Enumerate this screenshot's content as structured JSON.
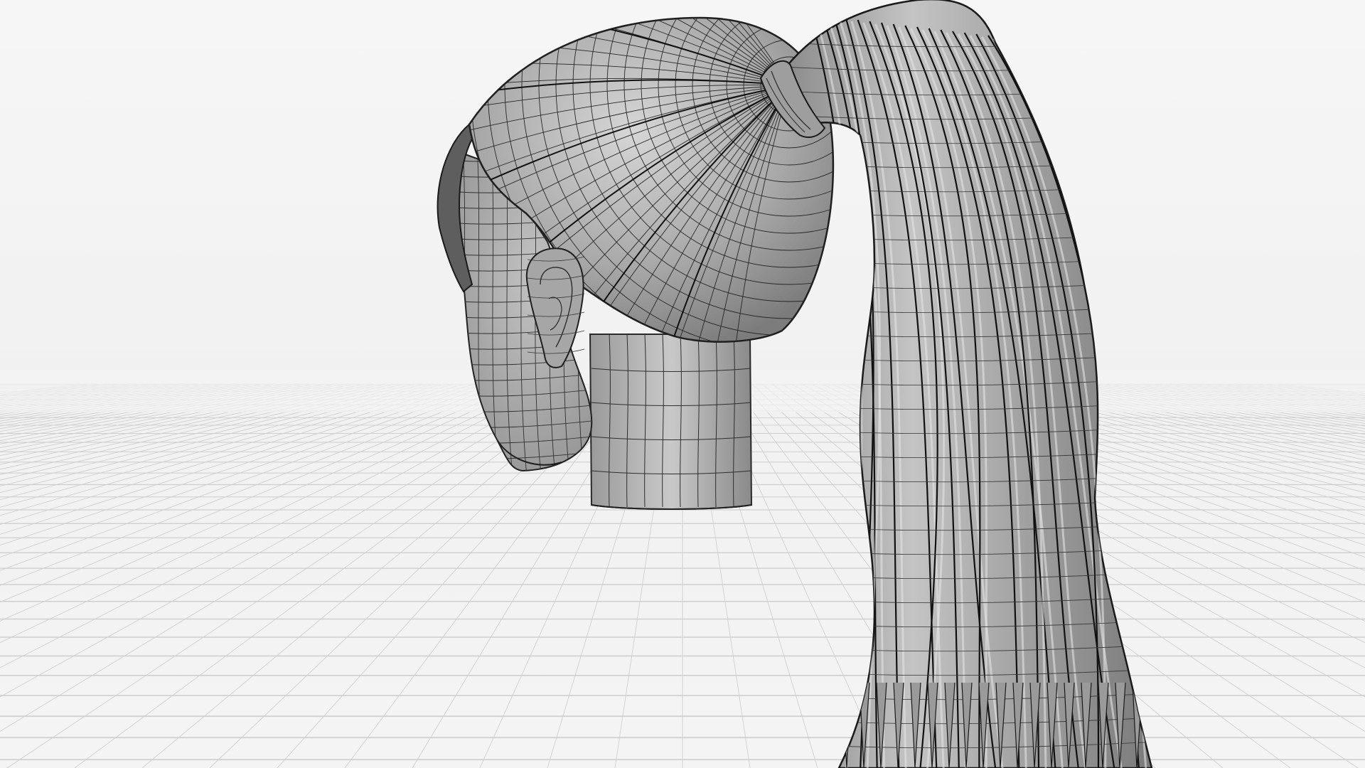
{
  "viewport": {
    "background_color": "#f3f3f3",
    "floor_line_color": "#cfcfcf",
    "mesh_fill_color": "#a9a9a9",
    "mesh_dark_color": "#6f6f6f",
    "mesh_light_color": "#d8d8d8",
    "wire_color": "#1c1c1c",
    "shading_mode": "solid-wireframe",
    "floor_grid": true
  },
  "model": {
    "object_icon": "ponytail-head-mesh"
  }
}
